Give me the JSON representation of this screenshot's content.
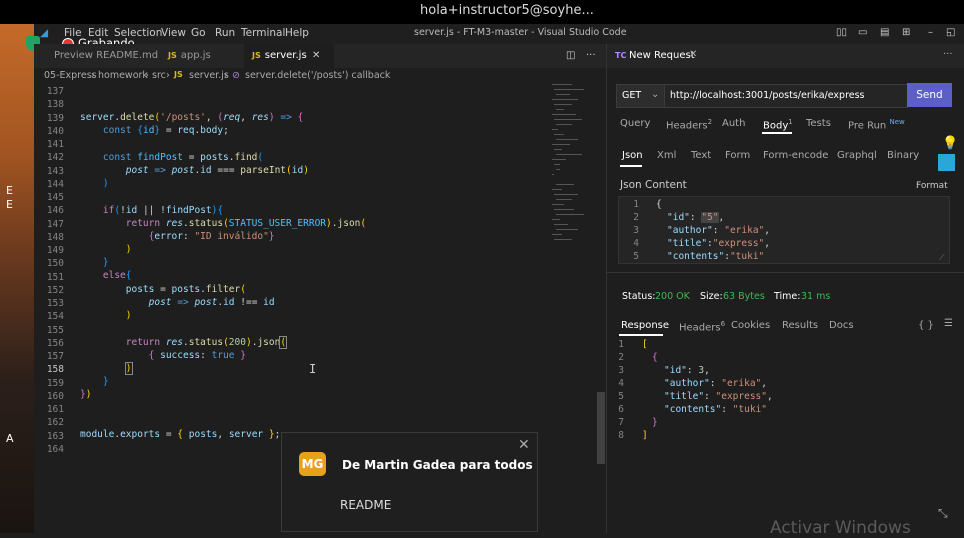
{
  "screen_caption": "hola+instructor5@soyhe...",
  "desktop_labels": [
    "E",
    "E",
    "A"
  ],
  "recording": {
    "label": "Grabando"
  },
  "vscode": {
    "menu": [
      "File",
      "Edit",
      "Selection",
      "View",
      "Go",
      "Run",
      "Terminal",
      "Help"
    ],
    "window_title": "server.js - FT-M3-master - Visual Studio Code",
    "tabs": [
      {
        "label": "Preview README.md"
      },
      {
        "label": "app.js"
      },
      {
        "label": "server.js"
      }
    ],
    "breadcrumb": [
      "05-Express",
      "homework",
      "src",
      "server.js",
      "server.delete('/posts') callback"
    ],
    "line_numbers": [
      "137",
      "138",
      "139",
      "140",
      "141",
      "142",
      "143",
      "144",
      "145",
      "146",
      "147",
      "148",
      "149",
      "150",
      "151",
      "152",
      "153",
      "154",
      "155",
      "156",
      "157",
      "158",
      "159",
      "160",
      "161",
      "162",
      "163",
      "164"
    ],
    "current_line": "158"
  },
  "thunder": {
    "tab_label": "New Request",
    "method": "GET",
    "url": "http://localhost:3001/posts/erika/express",
    "send_label": "Send",
    "req_tabs": [
      {
        "label": "Query",
        "count": ""
      },
      {
        "label": "Headers",
        "count": "2"
      },
      {
        "label": "Auth",
        "count": ""
      },
      {
        "label": "Body",
        "count": "1"
      },
      {
        "label": "Tests",
        "count": ""
      },
      {
        "label": "Pre Run",
        "count": "New"
      }
    ],
    "body_types": [
      "Json",
      "Xml",
      "Text",
      "Form",
      "Form-encode",
      "Graphql",
      "Binary"
    ],
    "json_content_label": "Json Content",
    "format_label": "Format",
    "json_lines": [
      {
        "n": "1",
        "text": "{"
      },
      {
        "n": "2",
        "key": "\"id\"",
        "val": "\"5\""
      },
      {
        "n": "3",
        "key": "\"author\"",
        "val": "\"erika\""
      },
      {
        "n": "4",
        "key": "\"title\"",
        "val": "\"express\""
      },
      {
        "n": "5",
        "key": "\"contents\"",
        "val": "\"tuki\""
      }
    ],
    "status": {
      "status_label": "Status:",
      "status_value": "200 OK",
      "size_label": "Size:",
      "size_value": "63 Bytes",
      "time_label": "Time:",
      "time_value": "31 ms"
    },
    "res_tabs": [
      {
        "label": "Response",
        "count": ""
      },
      {
        "label": "Headers",
        "count": "6"
      },
      {
        "label": "Cookies",
        "count": ""
      },
      {
        "label": "Results",
        "count": ""
      },
      {
        "label": "Docs",
        "count": ""
      }
    ],
    "res_braces": "{ }",
    "response_lines": [
      "1",
      "2",
      "3",
      "4",
      "5",
      "6",
      "7",
      "8"
    ]
  },
  "toast": {
    "avatar": "MG",
    "title": "De Martin Gadea para todos",
    "body": "README"
  },
  "watermark": "Activar Windows"
}
